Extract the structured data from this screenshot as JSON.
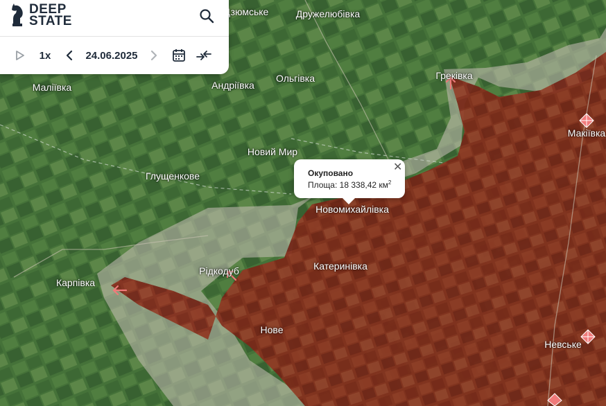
{
  "app": {
    "logo": {
      "line1": "DEEP",
      "line2": "STATE"
    }
  },
  "toolbar": {
    "play_icon": "play-icon",
    "speed": "1x",
    "date": "24.06.2025",
    "prev_icon": "chevron-left-icon",
    "next_icon": "chevron-right-icon",
    "calendar_icon": "calendar-icon",
    "compare_icon": "compare-arrows-icon",
    "search_icon": "search-icon"
  },
  "popup": {
    "title": "Окуповано",
    "area_label": "Площа:",
    "area_value": "18 338,42 км",
    "area_unit_power": "2",
    "close_symbol": "✕"
  },
  "map": {
    "places": {
      "dziomske": "Дзюмське",
      "druzheliubivka": "Дружелюбівка",
      "malivka": "Маліївка",
      "andriivka": "Андріївка",
      "olhivka": "Ольгівка",
      "hrekivka": "Греківка",
      "makiivka": "Макіївка",
      "novyi_myr": "Новий Мир",
      "hlushchenkove": "Глущенкове",
      "novomykhailivka": "Новомихайлівка",
      "karpivka": "Карпівка",
      "ridkodub": "Рідкодуб",
      "katerynivka": "Катеринівка",
      "nove": "Нове",
      "nevske": "Невське"
    },
    "colors": {
      "occupied": "#8b2a1a",
      "gray_zone": "#b9b2aa",
      "arrow": "#f07a7a",
      "diamond": "#f07a7a",
      "forest": "#3f6a36"
    }
  }
}
